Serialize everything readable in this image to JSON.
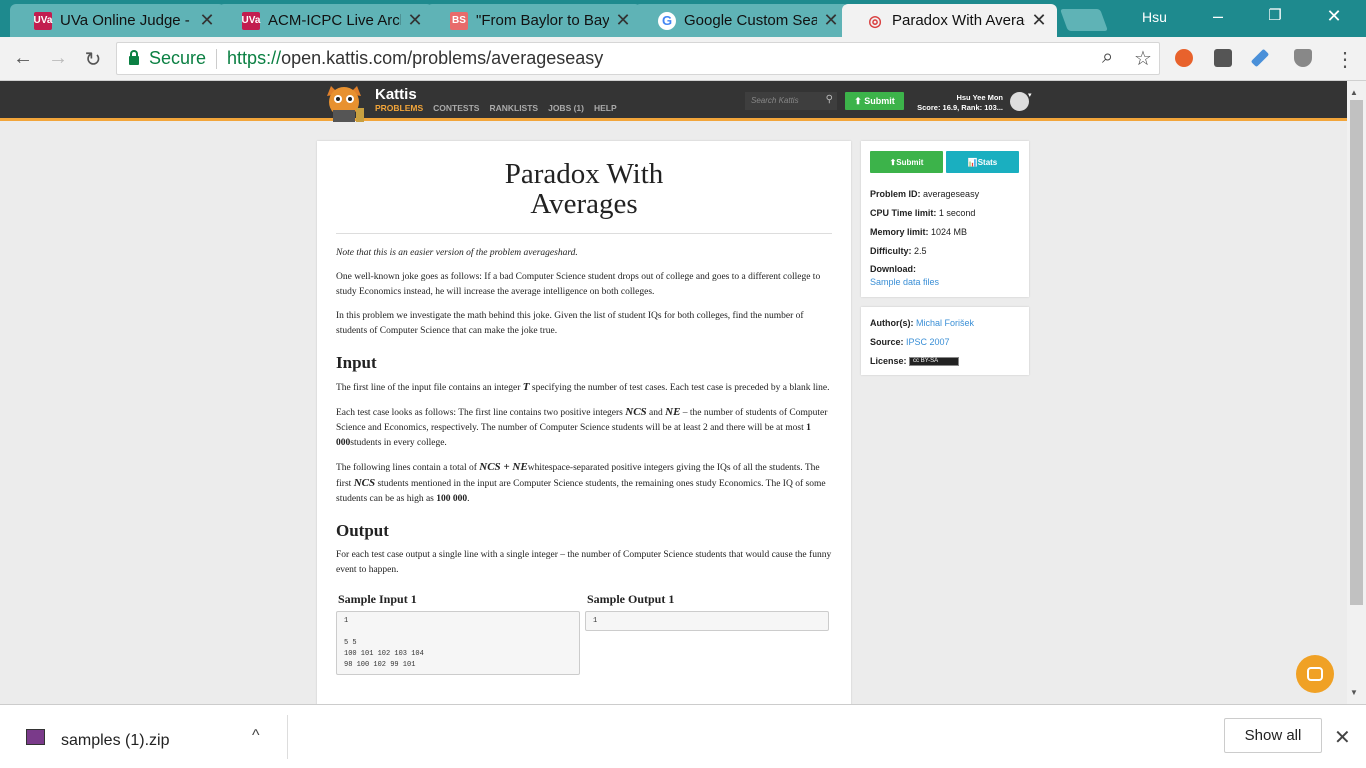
{
  "browser": {
    "tabs": [
      {
        "favicon": "UVa",
        "title": "UVa Online Judge - I",
        "favicon_color": "#c21d4f"
      },
      {
        "favicon": "UVa",
        "title": "ACM-ICPC Live Arch",
        "favicon_color": "#c21d4f"
      },
      {
        "favicon": "BS",
        "title": "\"From Baylor to Bayl",
        "favicon_color": "#e86b6b"
      },
      {
        "favicon": "G",
        "title": "Google Custom Sear",
        "favicon_color": "#4285f4"
      },
      {
        "favicon": "◎",
        "title": "Paradox With Averag",
        "favicon_color": "#d94040"
      }
    ],
    "profile_name": "Hsu",
    "window_minimize": "–",
    "window_restore": "❐",
    "window_close": "✕",
    "secure_label": "Secure",
    "url_scheme": "https://",
    "url_host": "open.kattis.com",
    "url_path": "/problems/averageseasy",
    "back_icon": "←",
    "forward_icon": "→",
    "reload_icon": "↻",
    "zoom_icon": "⌕",
    "star_icon": "☆",
    "menu_icon": "⋮",
    "tab_close_icon": "✕"
  },
  "kattis": {
    "brand": "Kattis",
    "nav": [
      "PROBLEMS",
      "CONTESTS",
      "RANKLISTS",
      "JOBS (1)",
      "HELP"
    ],
    "search_placeholder": "Search Kattis",
    "search_icon": "🔍",
    "submit_label": "⬆ Submit",
    "user_name": "Hsu Yee Mon",
    "user_score": "Score: 16.9, Rank: 103...",
    "caret": "▾",
    "accent_color": "#f2a53a"
  },
  "problem": {
    "title_line1": "Paradox With",
    "title_line2": "Averages",
    "note_prefix": "Note that this is an easier version of the problem ",
    "note_link": "averageshard",
    "note_suffix": ".",
    "intro_p1": "One well-known joke goes as follows: If a bad Computer Science student drops out of college and goes to a different college to study Economics instead, he will increase the average intelligence on both colleges.",
    "intro_p2": "In this problem we investigate the math behind this joke. Given the list of student IQs for both colleges, find the number of students of Computer Science that can make the joke true.",
    "input_heading": "Input",
    "input_p1_a": "The first line of the input file contains an integer ",
    "input_p1_var": "T",
    "input_p1_b": " specifying the number of test cases. Each test case is preceded by a blank line.",
    "input_p2_a": "Each test case looks as follows: The first line contains two positive integers ",
    "input_p2_var1": "NCS",
    "input_p2_and": " and ",
    "input_p2_var2": "NE",
    "input_p2_b": " – the number of students of Computer Science and Economics, respectively. The number of Computer Science students will be at least 2 and there will be at most ",
    "input_p2_max": "1 000",
    "input_p2_c": "students in every college.",
    "input_p3_a": "The following lines contain a total of ",
    "input_p3_var": "NCS + NE",
    "input_p3_b": "whitespace-separated positive integers giving the IQs of all the students. The first ",
    "input_p3_var2": "NCS",
    "input_p3_c": " students mentioned in the input are Computer Science students, the remaining ones study Economics. The IQ of some students can be as high as ",
    "input_p3_max": "100 000",
    "input_p3_d": ".",
    "output_heading": "Output",
    "output_p1": "For each test case output a single line with a single integer – the number of Computer Science students that would cause the funny event to happen.",
    "sample_input_title": "Sample Input 1",
    "sample_input": "1\n\n5 5\n100 101 102 103 104\n98 100 102 99 101",
    "sample_output_title": "Sample Output 1",
    "sample_output": "1"
  },
  "sidebar": {
    "submit_btn": "⬆Submit",
    "stats_btn": "📊Stats",
    "problem_id_label": "Problem ID:",
    "problem_id": "averageseasy",
    "cpu_label": "CPU Time limit:",
    "cpu": "1 second",
    "mem_label": "Memory limit:",
    "mem": "1024 MB",
    "difficulty_label": "Difficulty:",
    "difficulty": "2.5",
    "download_label": "Download:",
    "download_link": "Sample data files",
    "authors_label": "Author(s):",
    "authors": "Michal Forišek",
    "source_label": "Source:",
    "source": "IPSC 2007",
    "license_label": "License:",
    "license_badge": "cc BY-SA"
  },
  "download_shelf": {
    "file_name": "samples (1).zip",
    "caret": "^",
    "show_all": "Show all",
    "close": "✕"
  }
}
